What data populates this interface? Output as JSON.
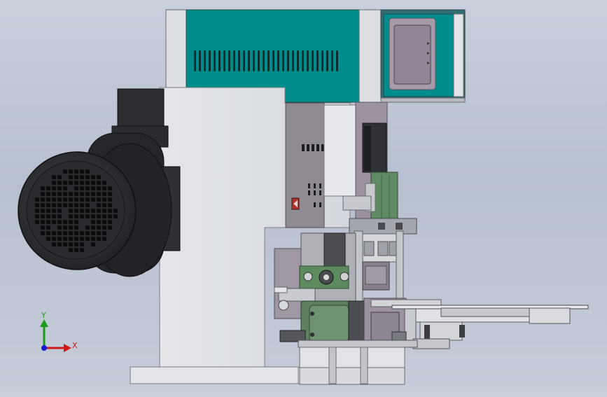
{
  "viewport": {
    "background_top": "#c9d0dc",
    "background_bottom": "#c6ccd8"
  },
  "coordinate_triad": {
    "y_label": "Y",
    "x_label": "X",
    "y_color": "#1a9a1a",
    "x_color": "#d01818",
    "z_color": "#1a1ad0"
  },
  "colors": {
    "teal_panel": "#008c8a",
    "machine_light": "#dfe1e5",
    "machine_mid": "#a7a9b3",
    "motor_dark": "#2c2d31",
    "green_component": "#5f8a63",
    "mauve_plate": "#9a8f9b"
  }
}
